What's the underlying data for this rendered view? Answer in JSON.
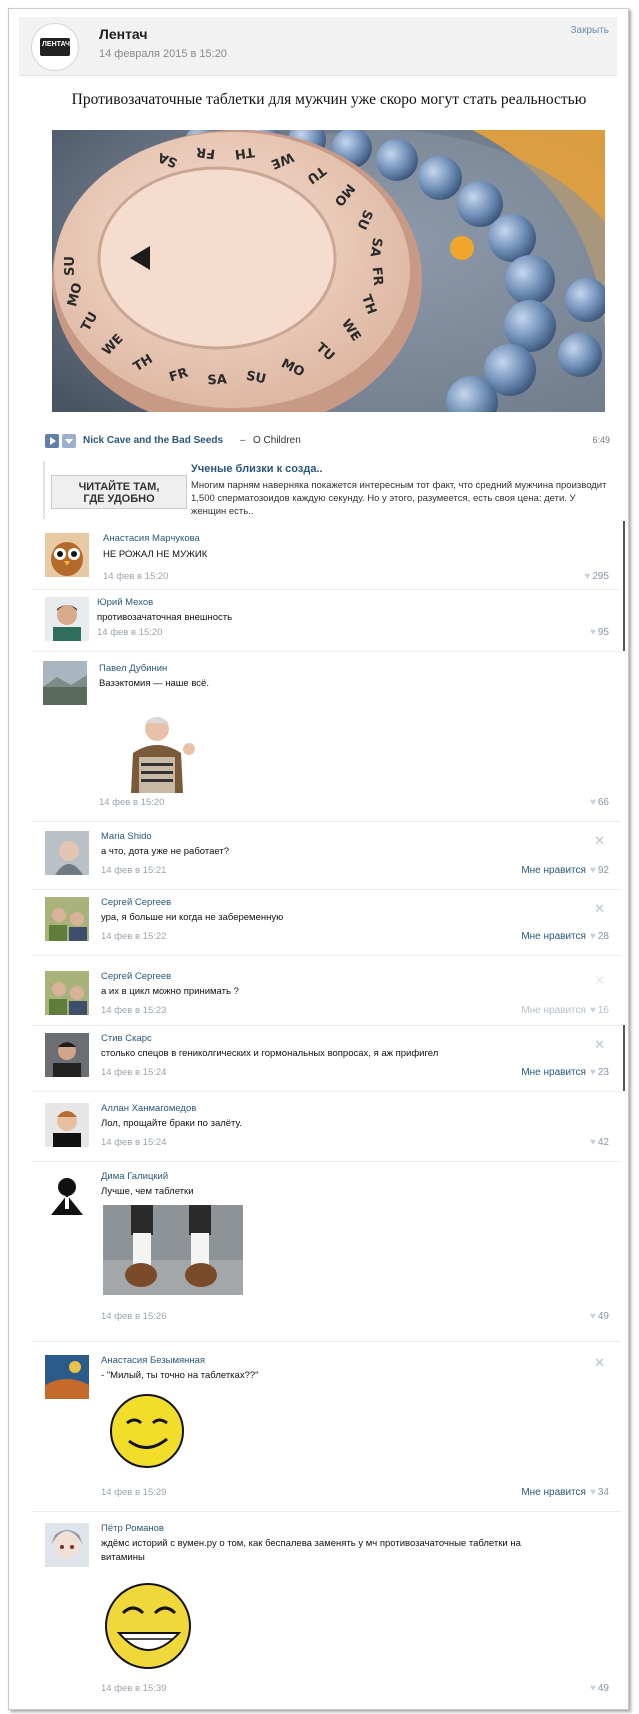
{
  "post": {
    "author": "Лентач",
    "logo_text": "ЛЕНТАЧ",
    "date": "14 февраля 2015 в 15:20",
    "close": "Закрыть",
    "headline": "Противозачаточные таблетки для мужчин уже скоро могут стать реальностью",
    "pill_days": [
      "SU",
      "MO",
      "TU",
      "WE",
      "TH",
      "FR",
      "SA",
      "SU",
      "MO",
      "TU",
      "WE",
      "TH",
      "FR",
      "SA",
      "SU",
      "MO",
      "TU",
      "WE",
      "TH",
      "FR",
      "SA"
    ]
  },
  "music": {
    "artist": "Nick Cave and the Bad Seeds",
    "dash": "–",
    "track": "O Children",
    "duration": "6:49"
  },
  "repost": {
    "thumb_line1": "ЧИТАЙТЕ ТАМ,",
    "thumb_line2": "ГДЕ УДОБНО",
    "title": "Ученые близки к созда..",
    "text": "Многим парням наверняка покажется интересным тот факт, что средний мужчина производит 1,500 сперматозоидов каждую секунду. Но у этого, разумеется, есть своя цена: дети. У женщин есть.."
  },
  "like_label": "Мне нравится",
  "comments": [
    {
      "name": "Анастасия Марчукова",
      "text": "НЕ РОЖАЛ НЕ МУЖИК",
      "date": "14 фев в 15:20",
      "likes": "295"
    },
    {
      "name": "Юрий Мехов",
      "text": "противозачаточная внешность",
      "date": "14 фев в 15:20",
      "likes": "95"
    },
    {
      "name": "Павел Дубинин",
      "text": "Вазэктомия — наше всё.",
      "date": "14 фев в 15:20",
      "likes": "66"
    },
    {
      "name": "Maria Shido",
      "text": "а что, дота уже не работает?",
      "date": "14 фев в 15:21",
      "likes": "92"
    },
    {
      "name": "Сергей Сергеев",
      "text": "ура, я больше ни когда не забеременную",
      "date": "14 фев в 15:22",
      "likes": "28"
    },
    {
      "name": "Сергей Сергеев",
      "text": "а их в цикл можно принимать ?",
      "date": "14 фев в 15:23",
      "likes": "16"
    },
    {
      "name": "Стив Скарс",
      "text": "столько спецов в гениколгических и гормональных вопросах, я аж прифигел",
      "date": "14 фев в 15:24",
      "likes": "23"
    },
    {
      "name": "Аллан Ханмагомедов",
      "text": "Лол, прощайте браки по залёту.",
      "date": "14 фев в 15:24",
      "likes": "42"
    },
    {
      "name": "Дима Галицкий",
      "text": "Лучше, чем таблетки",
      "date": "14 фев в 15:26",
      "likes": "49"
    },
    {
      "name": "Анастасия Безымянная",
      "text": "- \"Милый, ты точно на таблетках??\"",
      "date": "14 фев в 15:29",
      "likes": "34"
    },
    {
      "name": "Пётр Романов",
      "text": "ждёмс историй с вумен.ру о том, как беспалева заменять у мч противозачаточные таблетки на витамины",
      "date": "14 фев в 15:39",
      "likes": "49"
    }
  ]
}
